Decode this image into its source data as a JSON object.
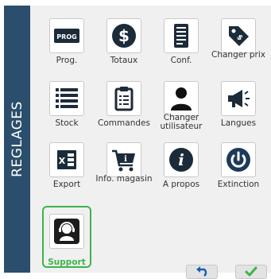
{
  "sidebar": {
    "title": "REGLAGES"
  },
  "tiles": [
    {
      "label": "Prog.",
      "icon": "prog-icon",
      "badge_text": "PROG"
    },
    {
      "label": "Totaux",
      "icon": "dollar-icon"
    },
    {
      "label": "Conf.",
      "icon": "receipt-icon"
    },
    {
      "label": "Changer prix",
      "icon": "price-tag-icon"
    },
    {
      "label": "Stock",
      "icon": "list-icon"
    },
    {
      "label": "Commandes",
      "icon": "clipboard-icon"
    },
    {
      "label": "Changer utilisateur",
      "icon": "user-icon"
    },
    {
      "label": "Langues",
      "icon": "megaphone-icon"
    },
    {
      "label": "Export",
      "icon": "excel-icon"
    },
    {
      "label": "Info. magasin",
      "icon": "shopping-cart-info-icon"
    },
    {
      "label": "A propos",
      "icon": "info-icon"
    },
    {
      "label": "Extinction",
      "icon": "power-icon"
    },
    {
      "label": "Support",
      "icon": "headset-support-icon",
      "selected": true
    }
  ],
  "footer": {
    "back_icon": "undo-arrow-icon",
    "confirm_icon": "checkmark-icon"
  },
  "colors": {
    "sidebar": "#2a4e6b",
    "accent_green": "#3db34a",
    "back_blue": "#1a5fb4",
    "dark_icon": "#2a2a2a"
  }
}
